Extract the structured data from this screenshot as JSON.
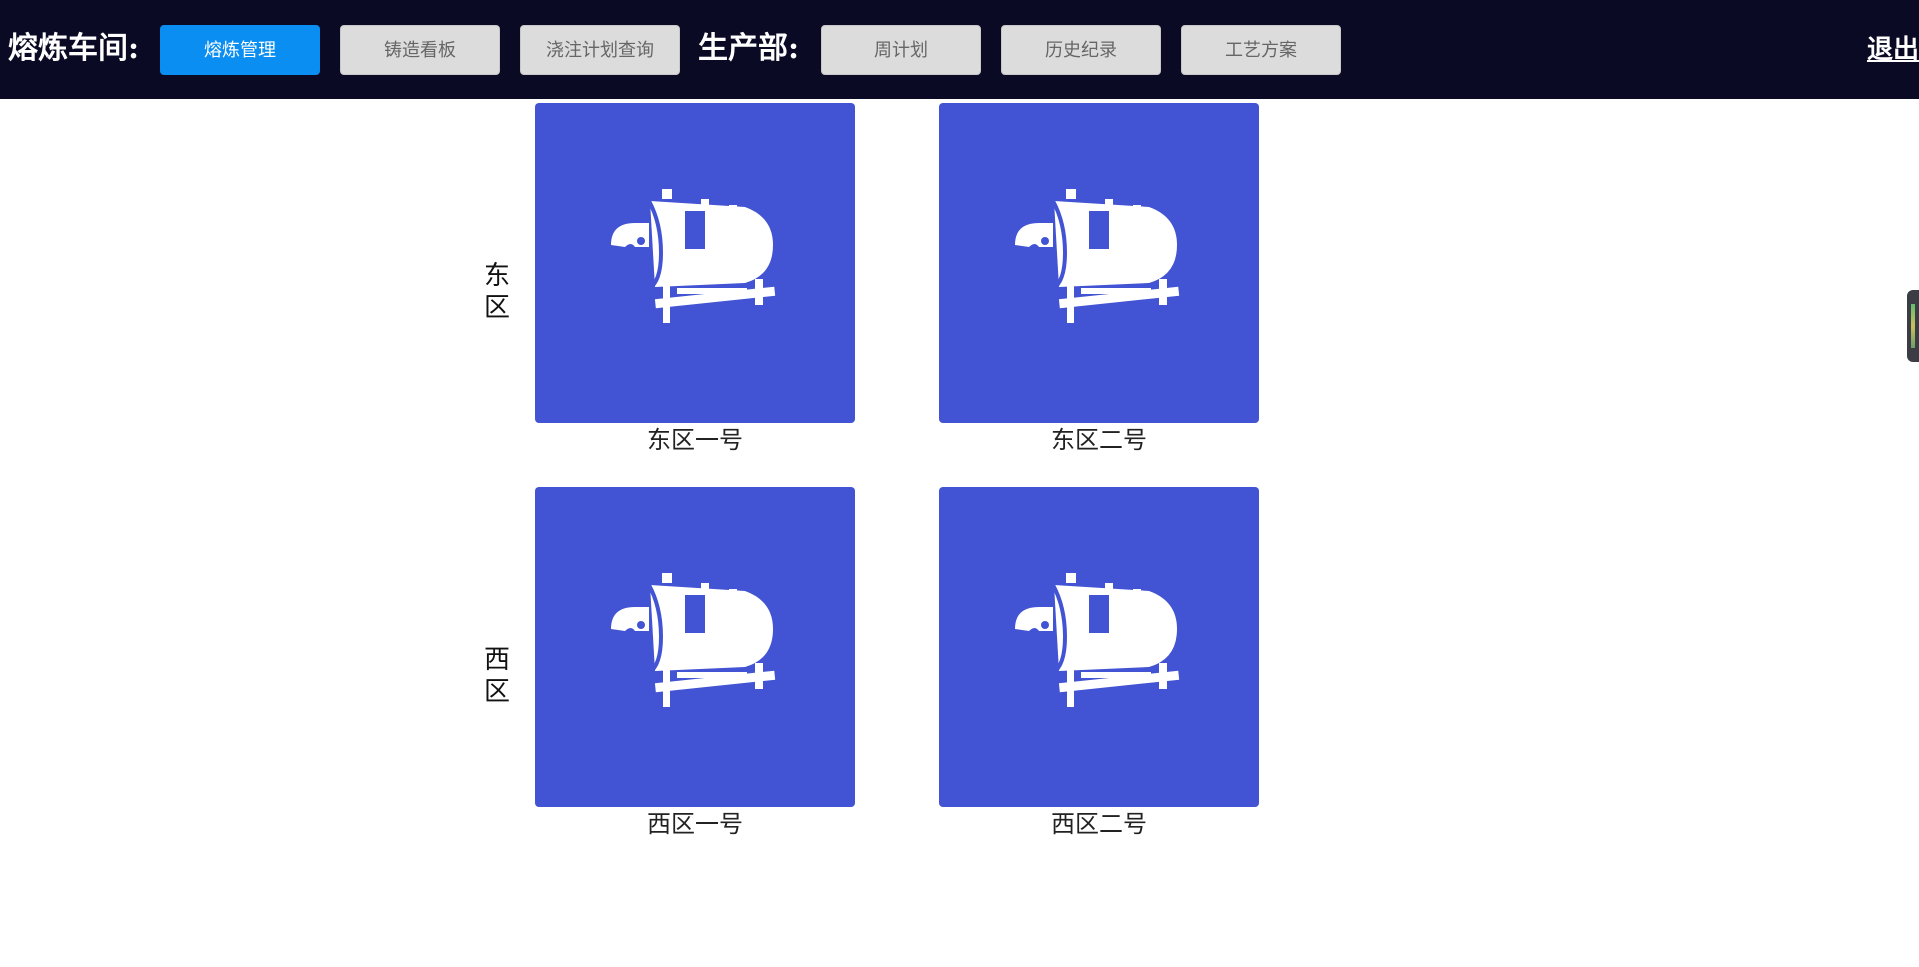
{
  "header": {
    "smelting_label": "熔炼车间:",
    "production_label": "生产部:",
    "logout_label": "退出"
  },
  "nav": {
    "smelting": [
      {
        "label": "熔炼管理",
        "active": true
      },
      {
        "label": "铸造看板",
        "active": false
      },
      {
        "label": "浇注计划查询",
        "active": false
      }
    ],
    "production": [
      {
        "label": "周计划",
        "active": false
      },
      {
        "label": "历史纪录",
        "active": false
      },
      {
        "label": "工艺方案",
        "active": false
      }
    ]
  },
  "zones": [
    {
      "label": "东区",
      "furnaces": [
        {
          "name": "东区一号",
          "icon": "boiler-icon"
        },
        {
          "name": "东区二号",
          "icon": "boiler-icon"
        }
      ]
    },
    {
      "label": "西区",
      "furnaces": [
        {
          "name": "西区一号",
          "icon": "boiler-icon"
        },
        {
          "name": "西区二号",
          "icon": "boiler-icon"
        }
      ]
    }
  ],
  "colors": {
    "header_bg": "#0b0a24",
    "active_button": "#0a8ef2",
    "tile_bg": "#4254d3"
  }
}
